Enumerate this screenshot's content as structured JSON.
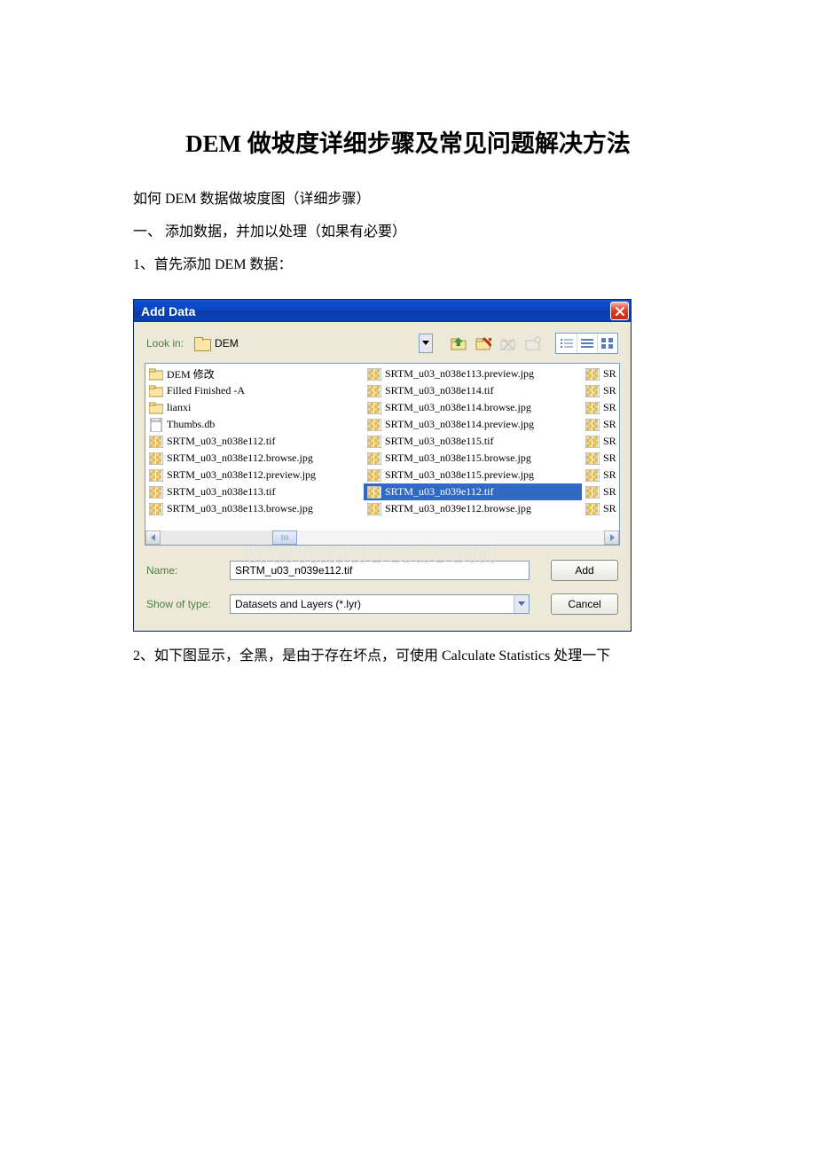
{
  "doc": {
    "title": "DEM 做坡度详细步骤及常见问题解决方法",
    "line1": "如何 DEM 数据做坡度图（详细步骤）",
    "line2": "一、 添加数据，并加以处理（如果有必要）",
    "line3": "1、首先添加 DEM 数据：",
    "line4": "2、如下图显示，全黑，是由于存在坏点，可使用 Calculate Statistics 处理一下"
  },
  "watermark": "www.bdocx.com",
  "dialog": {
    "title": "Add Data",
    "lookin_label": "Look in:",
    "lookin_value": "DEM",
    "name_label": "Name:",
    "name_value": "SRTM_u03_n039e112.tif",
    "type_label": "Show of type:",
    "type_value": "Datasets and Layers (*.lyr)",
    "add_btn": "Add",
    "cancel_btn": "Cancel",
    "col1": [
      {
        "icon": "folder",
        "label": "DEM 修改"
      },
      {
        "icon": "folder",
        "label": "Filled Finished -A"
      },
      {
        "icon": "folder",
        "label": "lianxi"
      },
      {
        "icon": "db",
        "label": "Thumbs.db"
      },
      {
        "icon": "raster",
        "label": "SRTM_u03_n038e112.tif"
      },
      {
        "icon": "raster",
        "label": "SRTM_u03_n038e112.browse.jpg"
      },
      {
        "icon": "raster",
        "label": "SRTM_u03_n038e112.preview.jpg"
      },
      {
        "icon": "raster",
        "label": "SRTM_u03_n038e113.tif"
      },
      {
        "icon": "raster",
        "label": "SRTM_u03_n038e113.browse.jpg"
      }
    ],
    "col2": [
      {
        "icon": "raster",
        "label": "SRTM_u03_n038e113.preview.jpg"
      },
      {
        "icon": "raster",
        "label": "SRTM_u03_n038e114.tif"
      },
      {
        "icon": "raster",
        "label": "SRTM_u03_n038e114.browse.jpg"
      },
      {
        "icon": "raster",
        "label": "SRTM_u03_n038e114.preview.jpg"
      },
      {
        "icon": "raster",
        "label": "SRTM_u03_n038e115.tif"
      },
      {
        "icon": "raster",
        "label": "SRTM_u03_n038e115.browse.jpg"
      },
      {
        "icon": "raster",
        "label": "SRTM_u03_n038e115.preview.jpg"
      },
      {
        "icon": "raster",
        "label": "SRTM_u03_n039e112.tif",
        "selected": true
      },
      {
        "icon": "raster",
        "label": "SRTM_u03_n039e112.browse.jpg"
      }
    ],
    "col3": [
      {
        "icon": "raster",
        "label": "SR"
      },
      {
        "icon": "raster",
        "label": "SR"
      },
      {
        "icon": "raster",
        "label": "SR"
      },
      {
        "icon": "raster",
        "label": "SR"
      },
      {
        "icon": "raster",
        "label": "SR"
      },
      {
        "icon": "raster",
        "label": "SR"
      },
      {
        "icon": "raster",
        "label": "SR"
      },
      {
        "icon": "raster",
        "label": "SR"
      },
      {
        "icon": "raster",
        "label": "SR"
      }
    ]
  }
}
